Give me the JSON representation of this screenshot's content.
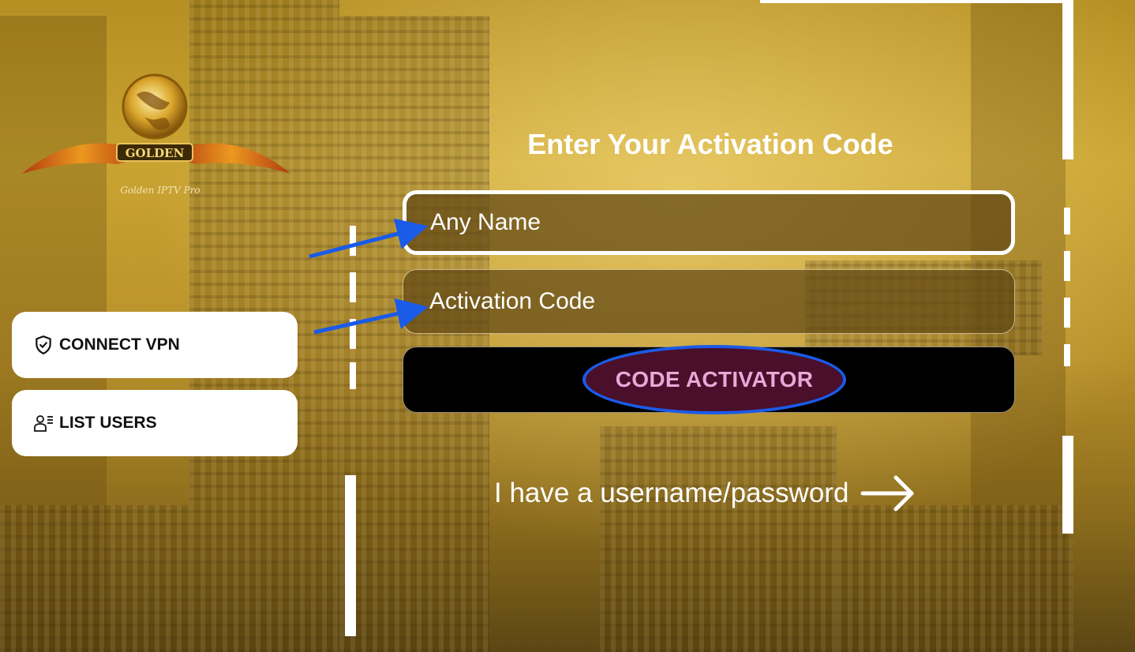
{
  "app": {
    "logo_text": "GOLDEN",
    "logo_caption": "Golden IPTV Pro"
  },
  "sidebar": {
    "items": [
      {
        "label": "CONNECT VPN",
        "icon": "shield-check-icon"
      },
      {
        "label": "LIST USERS",
        "icon": "users-list-icon"
      }
    ]
  },
  "form": {
    "title": "Enter Your Activation Code",
    "name_field": {
      "placeholder": "Any Name",
      "value": ""
    },
    "code_field": {
      "placeholder": "Activation Code",
      "value": ""
    },
    "submit_label": "CODE ACTIVATOR",
    "alt_link": "I have a username/password"
  },
  "colors": {
    "accent_annotation": "#1a5be8",
    "button_label": "#e6a9d8",
    "button_bg": "#000000"
  }
}
